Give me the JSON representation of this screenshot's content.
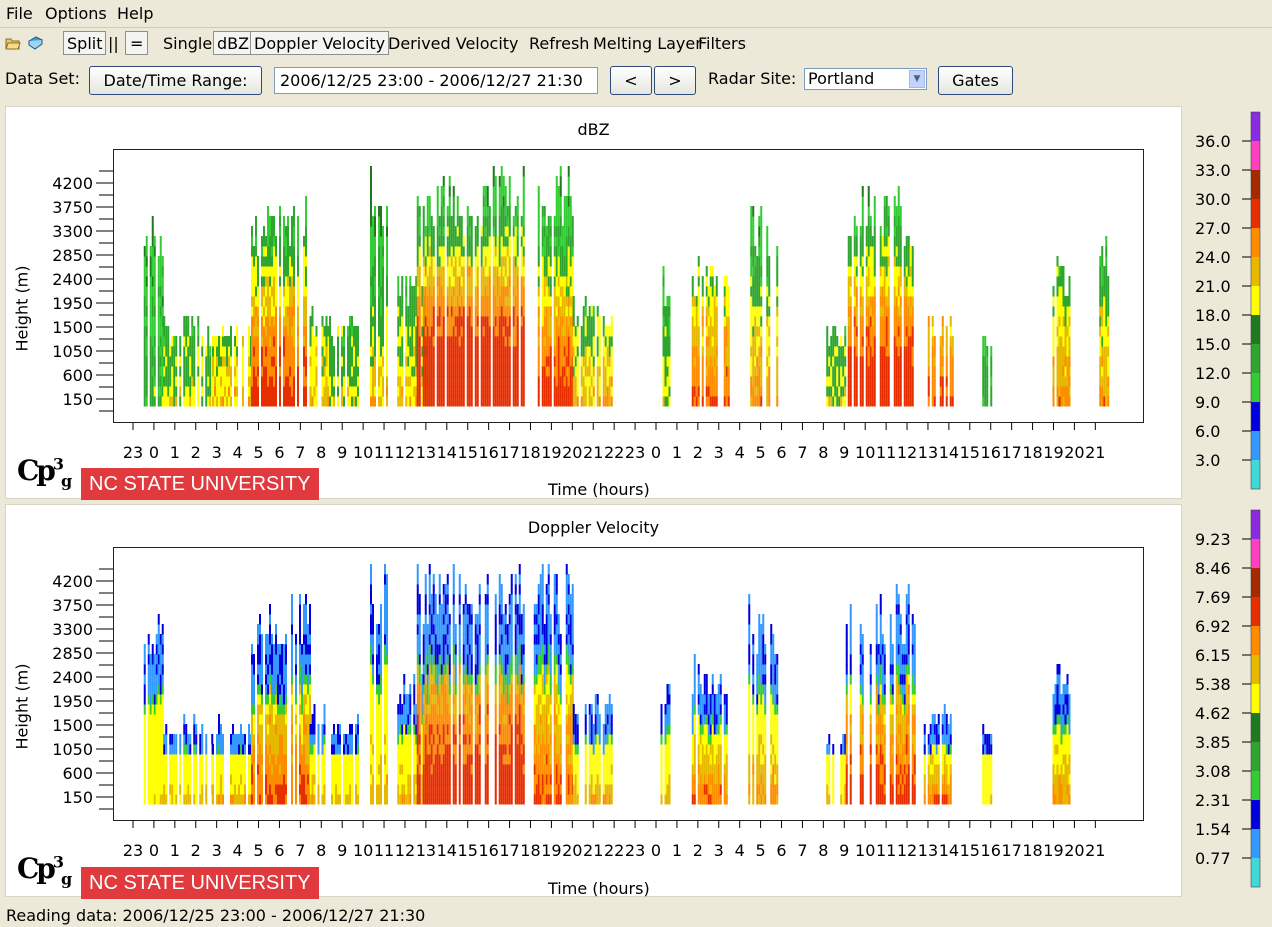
{
  "menu": [
    "File",
    "Options",
    "Help"
  ],
  "toolbar": {
    "split": "Split",
    "parallel": "||",
    "equal": "=",
    "single": "Single",
    "dbz": "dBZ",
    "doppler": "Doppler Velocity",
    "derived": "Derived Velocity",
    "refresh": "Refresh",
    "melting": "Melting Layer",
    "filters": "Filters"
  },
  "dataset": {
    "label": "Data Set:",
    "range_button": "Date/Time Range:",
    "range_value": "2006/12/25 23:00 - 2006/12/27 21:30",
    "prev": "<",
    "next": ">",
    "radar_label": "Radar Site:",
    "radar_value": "Portland",
    "gates_button": "Gates"
  },
  "logo": {
    "university": "NC STATE UNIVERSITY",
    "cp_text": "Cp",
    "cp_sup": "3",
    "cp_sub": "g"
  },
  "status": "Reading data: 2006/12/25 23:00 - 2006/12/27 21:30",
  "colors": {
    "scale": [
      "#3fd9d9",
      "#3399ff",
      "#0000dd",
      "#33cc33",
      "#2ea52e",
      "#1f7a1f",
      "#ffff00",
      "#e6b800",
      "#ff8c00",
      "#e62e00",
      "#a52a00",
      "#ff3fbf",
      "#8a2be2"
    ]
  },
  "chart_data": [
    {
      "type": "heatmap",
      "title": "dBZ",
      "xlabel": "Time (hours)",
      "ylabel": "Height (m)",
      "x_ticks": [
        "23",
        "0",
        "1",
        "2",
        "3",
        "4",
        "5",
        "6",
        "7",
        "8",
        "9",
        "10",
        "11",
        "12",
        "13",
        "14",
        "15",
        "16",
        "17",
        "18",
        "19",
        "20",
        "21",
        "22",
        "23",
        "0",
        "1",
        "2",
        "3",
        "4",
        "5",
        "6",
        "7",
        "8",
        "9",
        "10",
        "11",
        "12",
        "13",
        "14",
        "15",
        "16",
        "17",
        "18",
        "19",
        "20",
        "21"
      ],
      "y_ticks": [
        "150",
        "600",
        "1050",
        "1500",
        "1950",
        "2400",
        "2850",
        "3300",
        "3750",
        "4200"
      ],
      "colorbar": [
        "36.0",
        "33.0",
        "30.0",
        "27.0",
        "24.0",
        "21.0",
        "18.0",
        "15.0",
        "12.0",
        "9.0",
        "6.0",
        "3.0"
      ],
      "legend": "right"
    },
    {
      "type": "heatmap",
      "title": "Doppler Velocity",
      "xlabel": "Time (hours)",
      "ylabel": "Height (m)",
      "x_ticks": [
        "23",
        "0",
        "1",
        "2",
        "3",
        "4",
        "5",
        "6",
        "7",
        "8",
        "9",
        "10",
        "11",
        "12",
        "13",
        "14",
        "15",
        "16",
        "17",
        "18",
        "19",
        "20",
        "21",
        "22",
        "23",
        "0",
        "1",
        "2",
        "3",
        "4",
        "5",
        "6",
        "7",
        "8",
        "9",
        "10",
        "11",
        "12",
        "13",
        "14",
        "15",
        "16",
        "17",
        "18",
        "19",
        "20",
        "21"
      ],
      "y_ticks": [
        "150",
        "600",
        "1050",
        "1500",
        "1950",
        "2400",
        "2850",
        "3300",
        "3750",
        "4200"
      ],
      "colorbar": [
        "9.23",
        "8.46",
        "7.69",
        "6.92",
        "6.15",
        "5.38",
        "4.62",
        "3.85",
        "3.08",
        "2.31",
        "1.54",
        "0.77"
      ],
      "legend": "right"
    }
  ]
}
